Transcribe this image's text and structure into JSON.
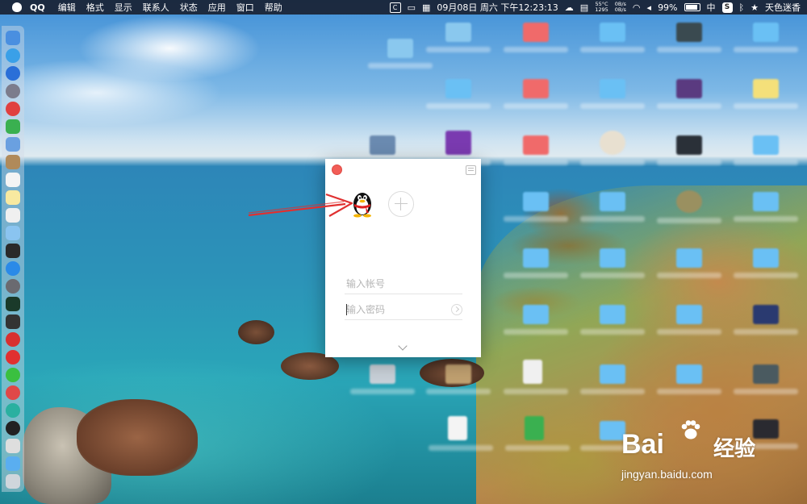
{
  "menubar": {
    "app_name": "QQ",
    "items": [
      "编辑",
      "格式",
      "显示",
      "联系人",
      "状态",
      "应用",
      "窗口",
      "帮助"
    ],
    "status": {
      "temp": "55°C",
      "fan": "1295",
      "net_up": "0B/s",
      "net_down": "0B/s",
      "datetime": "09月08日 周六 下午12:23:13",
      "battery": "99%",
      "ime": "中",
      "user": "天色迷香",
      "c_badge": "C",
      "s_badge": "S"
    }
  },
  "login": {
    "account_placeholder": "输入帐号",
    "password_placeholder": "输入密码"
  },
  "watermark": {
    "brand": "Bai",
    "brand_cn": "经验",
    "url": "jingyan.baidu.com"
  },
  "colors": {
    "close": "#f25d57",
    "annotation": "#e03030",
    "menubar": "#14141e"
  }
}
